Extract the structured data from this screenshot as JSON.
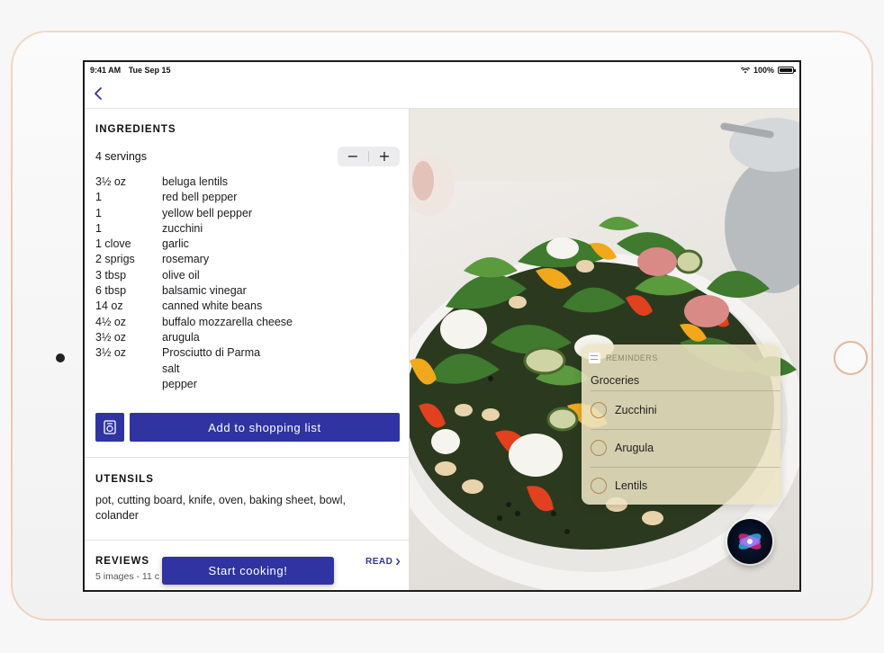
{
  "status_bar": {
    "time": "9:41 AM",
    "date": "Tue Sep 15",
    "battery": "100%"
  },
  "ingredients": {
    "title": "INGREDIENTS",
    "servings": "4 servings",
    "stepper": {
      "minus": "−",
      "plus": "+"
    },
    "items": [
      {
        "qty": "3½ oz",
        "name": "beluga lentils"
      },
      {
        "qty": "1",
        "name": "red bell pepper"
      },
      {
        "qty": "1",
        "name": "yellow bell pepper"
      },
      {
        "qty": "1",
        "name": "zucchini"
      },
      {
        "qty": "1 clove",
        "name": "garlic"
      },
      {
        "qty": "2 sprigs",
        "name": "rosemary"
      },
      {
        "qty": "3 tbsp",
        "name": "olive oil"
      },
      {
        "qty": "6 tbsp",
        "name": "balsamic vinegar"
      },
      {
        "qty": "14 oz",
        "name": "canned white beans"
      },
      {
        "qty": "4½ oz",
        "name": "buffalo mozzarella cheese"
      },
      {
        "qty": "3½ oz",
        "name": "arugula"
      },
      {
        "qty": "3½ oz",
        "name": "Prosciutto di Parma"
      },
      {
        "qty": "",
        "name": "salt"
      },
      {
        "qty": "",
        "name": "pepper"
      }
    ],
    "add_button": "Add to shopping list"
  },
  "utensils": {
    "title": "UTENSILS",
    "text": "pot, cutting board, knife, oven, baking sheet, bowl, colander"
  },
  "reviews": {
    "title": "REVIEWS",
    "subtitle": "5 images - 11 c",
    "read_link": "READ"
  },
  "start_button": "Start cooking!",
  "reminders": {
    "app_name": "REMINDERS",
    "list_title": "Groceries",
    "items": [
      "Zucchini",
      "Arugula",
      "Lentils"
    ]
  },
  "colors": {
    "accent": "#2f34a2",
    "reminder_circle": "#b3874a"
  },
  "icons": {
    "back": "chevron-left-icon",
    "scale": "kitchen-scale-icon",
    "siri": "siri-icon",
    "wifi": "wifi-icon",
    "battery": "battery-icon"
  }
}
